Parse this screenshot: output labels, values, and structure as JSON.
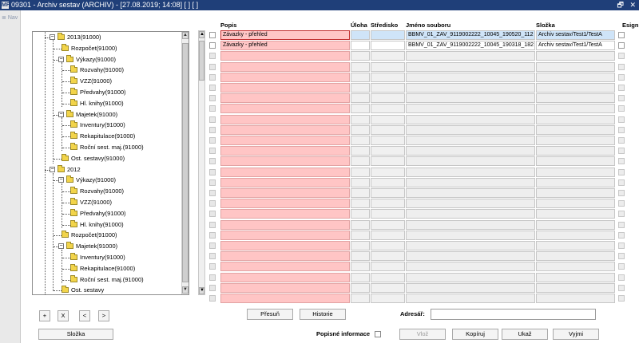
{
  "window": {
    "title": "09301 - Archiv sestav (ARCHIV) - [27.08.2019; 14:08]  [ ]  [ ]",
    "app_icon": "MF",
    "restore_icon": "restore-icon",
    "close_glyph": "✕"
  },
  "nav": {
    "label": "Nav"
  },
  "tree": {
    "nodes": [
      {
        "label": "2013(91000)",
        "expander": "−",
        "folder": false
      },
      {
        "label": "Rozpočet(91000)",
        "expander": "",
        "folder": true
      },
      {
        "label": "Výkazy(91000)",
        "expander": "−",
        "folder": true
      },
      {
        "label": "Rozvahy(91000)",
        "expander": "",
        "folder": true
      },
      {
        "label": "VZZ(91000)",
        "expander": "",
        "folder": true
      },
      {
        "label": "Předvahy(91000)",
        "expander": "",
        "folder": true
      },
      {
        "label": "Hl. knihy(91000)",
        "expander": "",
        "folder": true
      },
      {
        "label": "Majetek(91000)",
        "expander": "−",
        "folder": true
      },
      {
        "label": "Inventury(91000)",
        "expander": "",
        "folder": true
      },
      {
        "label": "Rekapitulace(91000)",
        "expander": "",
        "folder": true
      },
      {
        "label": "Roční sest. maj.(91000)",
        "expander": "",
        "folder": true
      },
      {
        "label": "Ost. sestavy(91000)",
        "expander": "",
        "folder": true
      },
      {
        "label": "2012",
        "expander": "−",
        "folder": true
      },
      {
        "label": "Výkazy(91000)",
        "expander": "−",
        "folder": true
      },
      {
        "label": "Rozvahy(91000)",
        "expander": "",
        "folder": true
      },
      {
        "label": "VZZ(91000)",
        "expander": "",
        "folder": true
      },
      {
        "label": "Předvahy(91000)",
        "expander": "",
        "folder": true
      },
      {
        "label": "Hl. knihy(91000)",
        "expander": "",
        "folder": true
      },
      {
        "label": "Rozpočet(91000)",
        "expander": "",
        "folder": true
      },
      {
        "label": "Majetek(91000)",
        "expander": "−",
        "folder": true
      },
      {
        "label": "Inventury(91000)",
        "expander": "",
        "folder": true
      },
      {
        "label": "Rekapitulace(91000)",
        "expander": "",
        "folder": true
      },
      {
        "label": "Roční sest. maj.(91000)",
        "expander": "",
        "folder": true
      },
      {
        "label": "Ost. sestavy",
        "expander": "",
        "folder": true
      }
    ]
  },
  "grid": {
    "headers": {
      "popis": "Popis",
      "uloha": "Úloha",
      "stredisko": "Středisko",
      "jmeno": "Jméno souboru",
      "slozka": "Složka",
      "esign": "Esign"
    },
    "rows": [
      {
        "popis": "Závazky - přehled",
        "uloha": "",
        "stredisko": "",
        "jmeno": "BBMV_01_ZAV_9119002222_10045_190520_112",
        "slozka": "Archiv sestav/Test1/TestA"
      },
      {
        "popis": "Závazky - přehled",
        "uloha": "",
        "stredisko": "",
        "jmeno": "BBMV_01_ZAV_9119002222_10045_190318_182",
        "slozka": "Archiv sestav/Test1/TestA"
      }
    ],
    "empty_rows": 24
  },
  "tree_buttons": {
    "add": "+",
    "remove": "X",
    "prev": "<",
    "next": ">"
  },
  "buttons": {
    "slozka": "Složka",
    "presun": "Přesuň",
    "historie": "Historie",
    "vloz": "Vlož",
    "kopiruj": "Kopíruj",
    "ukaz": "Ukaž",
    "vyjmi": "Vyjmi"
  },
  "fields": {
    "adresar_label": "Adresář:",
    "adresar_value": "",
    "popisne_label": "Popisné informace"
  }
}
